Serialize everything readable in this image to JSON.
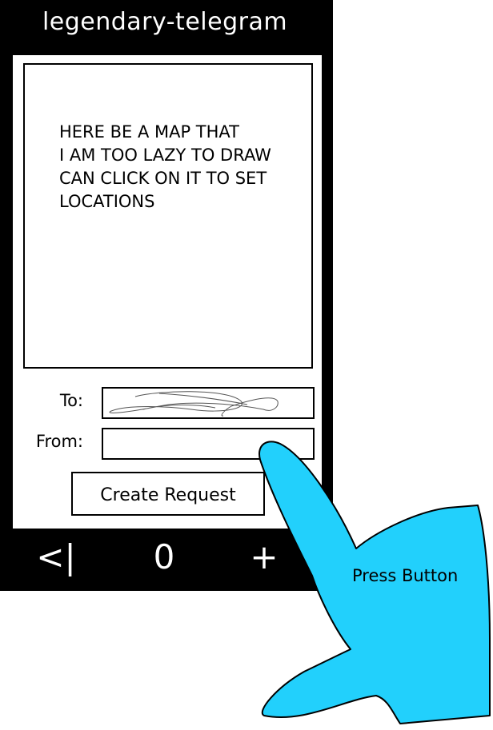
{
  "app": {
    "title": "legendary-telegram"
  },
  "map": {
    "lines": [
      "HERE BE A MAP THAT",
      "I AM TOO LAZY TO DRAW",
      "CAN CLICK ON IT TO SET",
      "LOCATIONS"
    ]
  },
  "form": {
    "to_label": "To:",
    "from_label": "From:",
    "to_value": "",
    "from_value": "",
    "submit_label": "Create Request"
  },
  "nav": {
    "back_label": "<|",
    "count_label": "0",
    "add_label": "+"
  },
  "annotation": {
    "label": "Press Button",
    "color": "#22d0fc"
  }
}
